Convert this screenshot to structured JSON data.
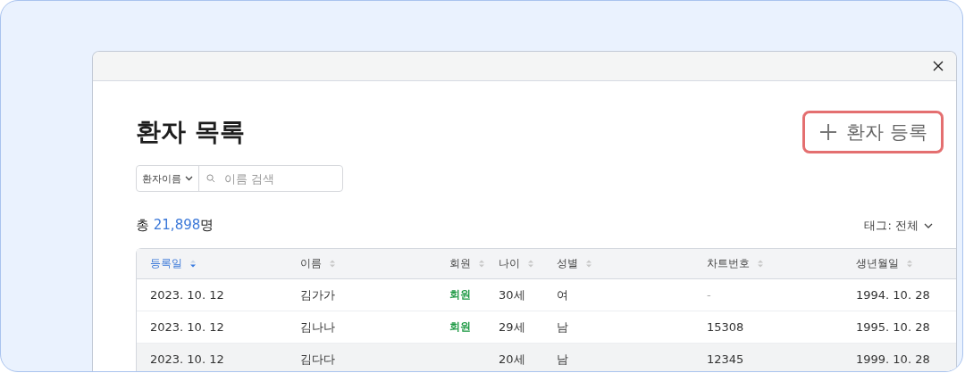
{
  "title": "환자 목록",
  "add_button": {
    "label": "환자 등록"
  },
  "search": {
    "filter": "환자이름",
    "placeholder": "이름 검색"
  },
  "total": {
    "prefix": "총 ",
    "count": "21,898",
    "suffix": "명"
  },
  "tag_filter": "태그: 전체",
  "table": {
    "columns": [
      {
        "label": "등록일",
        "sorted": true
      },
      {
        "label": "이름",
        "sorted": false
      },
      {
        "label": "회원",
        "sorted": false
      },
      {
        "label": "나이",
        "sorted": false
      },
      {
        "label": "성별",
        "sorted": false
      },
      {
        "label": "차트번호",
        "sorted": false
      },
      {
        "label": "생년월일",
        "sorted": false
      }
    ],
    "rows": [
      {
        "selected": false,
        "cells": [
          "2023. 10. 12",
          "김가가",
          "회원",
          "30세",
          "여",
          "-",
          "1994. 10. 28"
        ]
      },
      {
        "selected": false,
        "cells": [
          "2023. 10. 12",
          "김나나",
          "회원",
          "29세",
          "남",
          "15308",
          "1995. 10. 28"
        ]
      },
      {
        "selected": true,
        "cells": [
          "2023. 10. 12",
          "김다다",
          "",
          "20세",
          "남",
          "12345",
          "1999. 10. 28"
        ]
      }
    ]
  }
}
